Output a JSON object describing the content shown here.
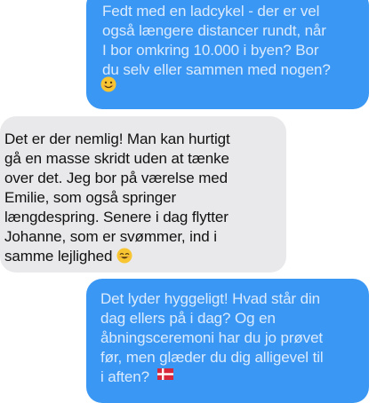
{
  "conversation": {
    "messages": [
      {
        "sender": "me",
        "text": "Fedt med en ladcykel - der er vel\nogså længere distancer rundt, når\nI bor omkring 10.000 i byen? Bor\ndu selv eller sammen med nogen?",
        "emoji": "smiling-face-icon"
      },
      {
        "sender": "other",
        "text": "Det er der nemlig! Man kan hurtigt\ngå en masse skridt uden at tænke\nover det. Jeg bor på værelse med\nEmilie, som også springer\nlængdespring. Senere i dag flytter\nJohanne, som er svømmer, ind i\nsamme lejlighed",
        "emoji": "smiling-face-icon"
      },
      {
        "sender": "me",
        "text": "Det lyder hyggeligt! Hvad står din\ndag ellers på i dag? Og en\nåbningsceremoni har du jo prøvet\nfør, men glæder du dig alligevel til\ni aften?",
        "emoji": "danish-flag-icon"
      }
    ]
  },
  "colors": {
    "sent_bubble": "#3a98f4",
    "received_bubble": "#e9e9eb"
  }
}
